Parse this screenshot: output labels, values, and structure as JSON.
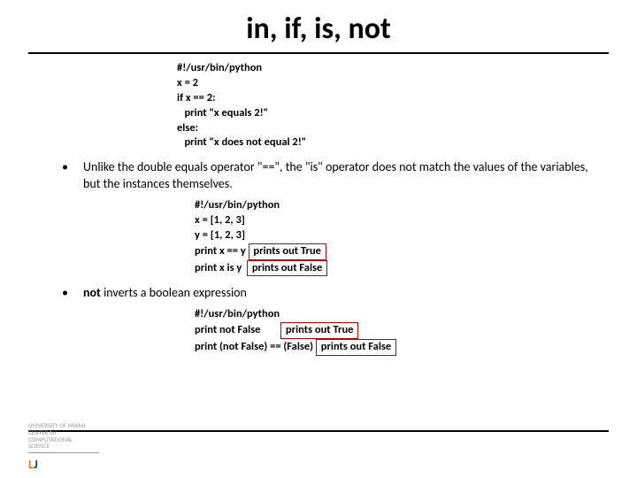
{
  "title": "in, if, is, not",
  "code1": {
    "l1": "#!/usr/bin/python",
    "l2": "x = 2",
    "l3": "if x == 2:",
    "l4": "   print \"x equals 2!\"",
    "l5": "else:",
    "l6": "   print \"x does not equal 2!\""
  },
  "bullet1": "Unlike the double equals operator \"==\", the \"is\" operator does not match the values of the variables, but the instances themselves.",
  "code2": {
    "l1": "#!/usr/bin/python",
    "l2": "x = [1, 2, 3]",
    "l3": "y = [1, 2, 3]",
    "l4a": "print x == y ",
    "l4b": " prints out True ",
    "l5a": "print x is y  ",
    "l5b": " prints out False "
  },
  "bullet2_prefix": "not",
  "bullet2_rest": " inverts a boolean expression",
  "code3": {
    "l1": "#!/usr/bin/python",
    "l2a": "print not False        ",
    "l2b": " prints out True ",
    "l3a": "print (not False) == (False) ",
    "l3b": " prints out False "
  },
  "footer": {
    "l1": "UNIVERSITY OF MIAMI",
    "l2": "CENTER for",
    "l3": "COMPUTATIONAL",
    "l4": "SCIENCE"
  }
}
